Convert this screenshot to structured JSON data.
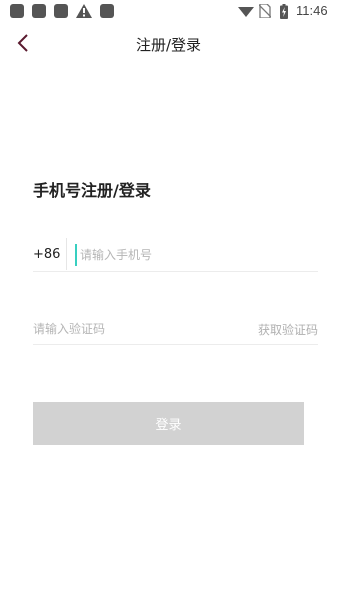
{
  "status_bar": {
    "time": "11:46",
    "icons": [
      "notification-icon",
      "notification-icon",
      "notification-icon",
      "warning-icon",
      "notification-icon",
      "wifi-icon",
      "no-sim-icon",
      "battery-charging-icon"
    ]
  },
  "header": {
    "back_icon": "chevron-left-icon",
    "title": "注册/登录"
  },
  "form": {
    "heading": "手机号注册/登录",
    "country_code": "+86",
    "phone_placeholder": "请输入手机号",
    "code_placeholder": "请输入验证码",
    "get_code_label": "获取验证码",
    "login_label": "登录"
  },
  "colors": {
    "accent": "#38cfc0",
    "back_arrow": "#5a1a2e",
    "button_disabled": "#d2d2d2"
  }
}
